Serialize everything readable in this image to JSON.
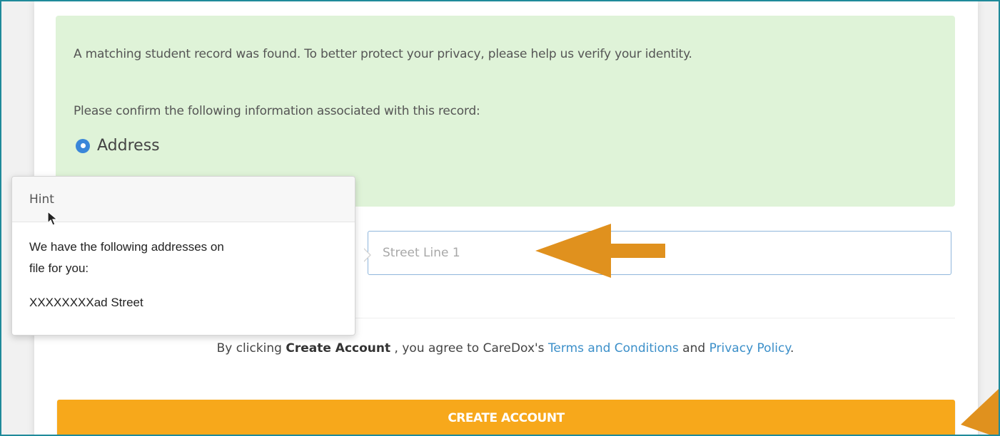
{
  "alert": {
    "match_message": "A matching student record was found. To better protect your privacy, please help us verify your identity.",
    "confirm_message": "Please confirm the following information associated with this record:",
    "radio_label": "Address"
  },
  "hint": {
    "title": "Hint",
    "line1": "We have the following addresses on",
    "line2": "file for you:",
    "address": "XXXXXXXXad Street"
  },
  "street_input": {
    "placeholder": "Street Line 1",
    "value": ""
  },
  "terms": {
    "prefix": "By clicking ",
    "bold": "Create Account",
    "middle": " , you agree to CareDox's ",
    "terms_link": "Terms and Conditions",
    "and": " and ",
    "privacy_link": "Privacy Policy",
    "suffix": "."
  },
  "create_button": {
    "label": "CREATE ACCOUNT"
  },
  "colors": {
    "accent_orange": "#f7a81b",
    "annotation_arrow": "#e0911e",
    "alert_green": "#dff3d8",
    "link_blue": "#3b8fc9",
    "radio_blue": "#3a86d9",
    "frame_teal": "#1f8a9a"
  },
  "icons": {
    "radio": "radio-selected-icon",
    "cursor": "mouse-pointer-icon",
    "arrow": "left-arrow-annotation-icon"
  }
}
